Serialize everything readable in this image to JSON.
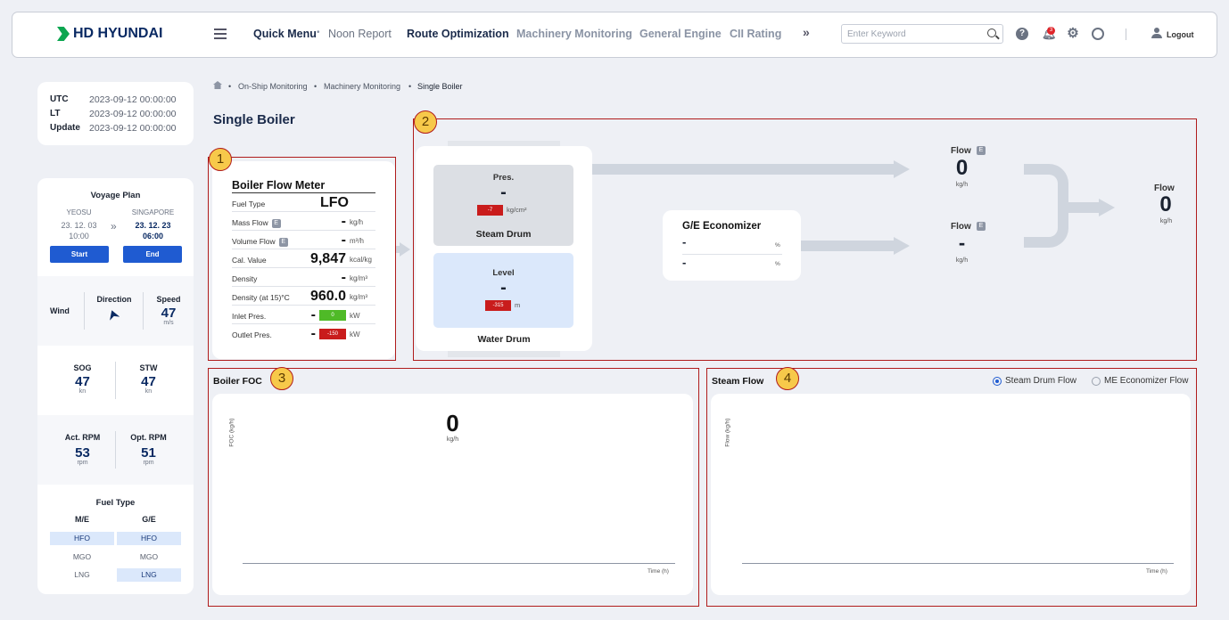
{
  "header": {
    "logo": "HD HYUNDAI",
    "nav": [
      "Quick Menu",
      "Noon Report",
      "Route Optimization",
      "Machinery Monitoring",
      "General Engine",
      "CII Rating"
    ],
    "more": "»",
    "search_placeholder": "Enter Keyword",
    "notif_count": "3",
    "logout": "Logout"
  },
  "time": {
    "utc_label": "UTC",
    "utc": "2023-09-12 00:00:00",
    "lt_label": "LT",
    "lt": "2023-09-12 00:00:00",
    "upd_label": "Update",
    "upd": "2023-09-12 00:00:00"
  },
  "voyage": {
    "title": "Voyage Plan",
    "from": "YEOSU",
    "to": "SINGAPORE",
    "from_date": "23. 12. 03",
    "from_time": "10:00",
    "to_date": "23. 12. 23",
    "to_time": "06:00",
    "start": "Start",
    "end": "End"
  },
  "wind": {
    "label": "Wind",
    "dir_label": "Direction",
    "speed_label": "Speed",
    "speed": "47",
    "unit": "m/s"
  },
  "speed": {
    "sog_label": "SOG",
    "sog": "47",
    "stw_label": "STW",
    "stw": "47",
    "unit": "kn"
  },
  "rpm": {
    "act_label": "Act. RPM",
    "act": "53",
    "opt_label": "Opt. RPM",
    "opt": "51",
    "unit": "rpm"
  },
  "fuel": {
    "title": "Fuel Type",
    "me": "M/E",
    "ge": "G/E",
    "me_items": [
      "HFO",
      "MGO",
      "LNG"
    ],
    "ge_items": [
      "HFO",
      "MGO",
      "LNG"
    ]
  },
  "breadcrumb": [
    "On-Ship Monitoring",
    "Machinery Monitoring",
    "Single Boiler"
  ],
  "page_title": "Single Boiler",
  "flow_meter": {
    "title": "Boiler Flow Meter",
    "rows": [
      {
        "k": "Fuel Type",
        "v": "LFO",
        "u": ""
      },
      {
        "k": "Mass Flow",
        "v": "-",
        "u": "kg/h",
        "e": "E"
      },
      {
        "k": "Volume Flow",
        "v": "-",
        "u": "m³/h",
        "e": "E"
      },
      {
        "k": "Cal. Value",
        "v": "9,847",
        "u": "kcal/kg"
      },
      {
        "k": "Density",
        "v": "-",
        "u": "kg/m³"
      },
      {
        "k": "Density (at 15)°C",
        "v": "960.0",
        "u": "kg/m³"
      },
      {
        "k": "Inlet Pres.",
        "v": "-",
        "u": "kW",
        "bar": "0"
      },
      {
        "k": "Outlet Pres.",
        "v": "-",
        "u": "kW",
        "bar": "-150"
      }
    ]
  },
  "drum": {
    "pres_label": "Pres.",
    "pres": "-",
    "pres_bar": "-7",
    "pres_unit": "kg/cm²",
    "steam": "Steam Drum",
    "level_label": "Level",
    "level": "-",
    "level_bar": "-315",
    "level_unit": "m",
    "water": "Water Drum"
  },
  "economizer": {
    "title": "G/E Economizer",
    "v1": "-",
    "u1": "%",
    "v2": "-",
    "u2": "%"
  },
  "flows": {
    "f1_label": "Flow",
    "f1": "0",
    "f1_unit": "kg/h",
    "f2_label": "Flow",
    "f2": "-",
    "f2_unit": "kg/h",
    "f3_label": "Flow",
    "f3": "0",
    "f3_unit": "kg/h",
    "e": "E"
  },
  "foc": {
    "title": "Boiler FOC",
    "ylabel": "FOC (kg/h)",
    "value": "0",
    "unit": "kg/h",
    "xlabel": "Time (h)"
  },
  "steam_flow": {
    "title": "Steam Flow",
    "opt1": "Steam Drum Flow",
    "opt2": "ME Economizer Flow",
    "ylabel": "Flow (kg/h)",
    "xlabel": "Time (h)"
  },
  "annotations": [
    "1",
    "2",
    "3",
    "4"
  ]
}
